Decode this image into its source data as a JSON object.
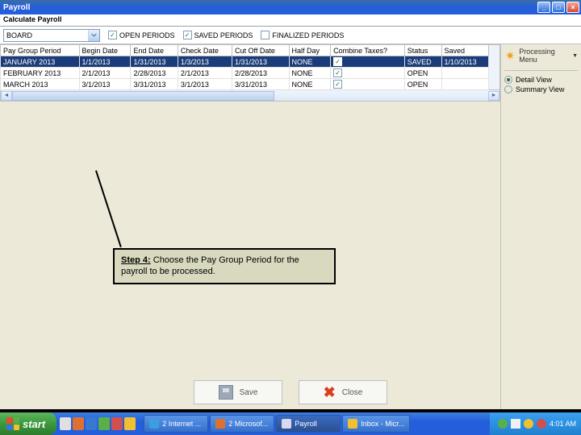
{
  "title_bar": {
    "title": "Payroll"
  },
  "subtitle": "Calculate Payroll",
  "filter": {
    "combo_value": "BOARD",
    "open_periods": "OPEN PERIODS",
    "saved_periods": "SAVED PERIODS",
    "finalized_periods": "FINALIZED PERIODS"
  },
  "table": {
    "headers": [
      "Pay Group Period",
      "Begin Date",
      "End Date",
      "Check Date",
      "Cut Off Date",
      "Half Day",
      "Combine Taxes?",
      "Status",
      "Saved"
    ],
    "rows": [
      {
        "period": "JANUARY 2013",
        "begin": "1/1/2013",
        "end": "1/31/2013",
        "check": "1/3/2013",
        "cutoff": "1/31/2013",
        "half": "NONE",
        "combine": true,
        "status": "SAVED",
        "saved": "1/10/2013",
        "selected": true
      },
      {
        "period": "FEBRUARY 2013",
        "begin": "2/1/2013",
        "end": "2/28/2013",
        "check": "2/1/2013",
        "cutoff": "2/28/2013",
        "half": "NONE",
        "combine": true,
        "status": "OPEN",
        "saved": "",
        "selected": false
      },
      {
        "period": "MARCH 2013",
        "begin": "3/1/2013",
        "end": "3/31/2013",
        "check": "3/1/2013",
        "cutoff": "3/31/2013",
        "half": "NONE",
        "combine": true,
        "status": "OPEN",
        "saved": "",
        "selected": false
      }
    ]
  },
  "right_panel": {
    "processing_menu": "Processing Menu",
    "detail_view": "Detail View",
    "summary_view": "Summary View"
  },
  "callout": {
    "step_label": "Step 4:",
    "text": " Choose the Pay Group Period for the payroll to be processed."
  },
  "buttons": {
    "save": "Save",
    "close": "Close"
  },
  "taskbar": {
    "start": "start",
    "tasks": [
      {
        "label": "2 Internet ...",
        "color": "#3a9fe0"
      },
      {
        "label": "2 Microsof...",
        "color": "#e07030"
      },
      {
        "label": "Payroll",
        "color": "#d8d8f0",
        "active": true
      },
      {
        "label": "Inbox - Micr...",
        "color": "#f0c030"
      }
    ],
    "clock": "4:01 AM"
  }
}
